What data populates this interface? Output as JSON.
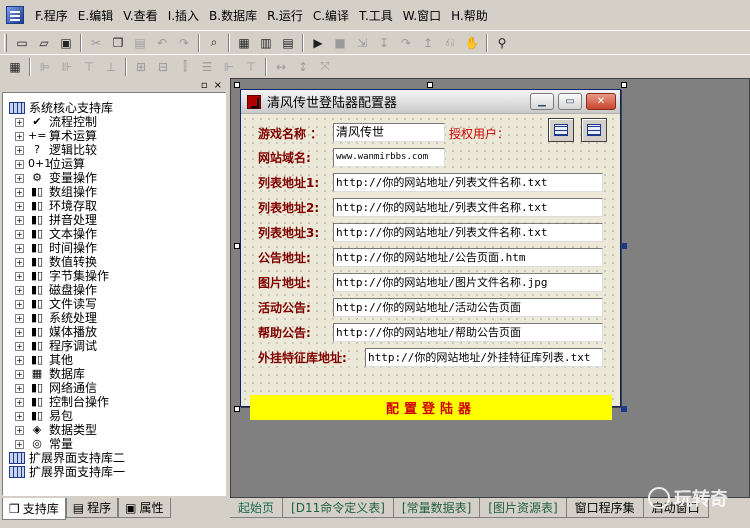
{
  "menu": [
    "F.程序",
    "E.编辑",
    "V.查看",
    "I.插入",
    "B.数据库",
    "R.运行",
    "C.编译",
    "T.工具",
    "W.窗口",
    "H.帮助"
  ],
  "panel_controls": [
    "▫",
    "×"
  ],
  "tree": {
    "root": "系统核心支持库",
    "children": [
      {
        "icon": "✔",
        "label": "流程控制"
      },
      {
        "icon": "+=",
        "label": "算术运算"
      },
      {
        "icon": "?",
        "label": "逻辑比较"
      },
      {
        "icon": "0+1",
        "label": "位运算"
      },
      {
        "icon": "⚙",
        "label": "变量操作"
      },
      {
        "icon": "▮▯",
        "label": "数组操作"
      },
      {
        "icon": "▮▯",
        "label": "环境存取"
      },
      {
        "icon": "▮▯",
        "label": "拼音处理"
      },
      {
        "icon": "▮▯",
        "label": "文本操作"
      },
      {
        "icon": "▮▯",
        "label": "时间操作"
      },
      {
        "icon": "▮▯",
        "label": "数值转换"
      },
      {
        "icon": "▮▯",
        "label": "字节集操作"
      },
      {
        "icon": "▮▯",
        "label": "磁盘操作"
      },
      {
        "icon": "▮▯",
        "label": "文件读写"
      },
      {
        "icon": "▮▯",
        "label": "系统处理"
      },
      {
        "icon": "▮▯",
        "label": "媒体播放"
      },
      {
        "icon": "▮▯",
        "label": "程序调试"
      },
      {
        "icon": "▮▯",
        "label": "其他"
      },
      {
        "icon": "▦",
        "label": "数据库"
      },
      {
        "icon": "▮▯",
        "label": "网络通信"
      },
      {
        "icon": "▮▯",
        "label": "控制台操作"
      },
      {
        "icon": "▮▯",
        "label": "易包"
      },
      {
        "icon": "◈",
        "label": "数据类型"
      },
      {
        "icon": "◎",
        "label": "常量"
      }
    ],
    "extra_roots": [
      "扩展界面支持库二",
      "扩展界面支持库一"
    ]
  },
  "left_tabs": [
    "支持库",
    "程序",
    "属性"
  ],
  "form": {
    "title": "清风传世登陆器配置器",
    "rows": {
      "game_name_label": "游戏名称 ：",
      "game_name_value": "清风传世",
      "authorized_label": "授权用户：",
      "domain_label": "网站域名:",
      "domain_value": "www.wanmirbbs.com",
      "list1_label": "列表地址1:",
      "list1_value": "http://你的网站地址/列表文件名称.txt",
      "list2_label": "列表地址2:",
      "list2_value": "http://你的网站地址/列表文件名称.txt",
      "list3_label": "列表地址3:",
      "list3_value": "http://你的网站地址/列表文件名称.txt",
      "notice_label": "公告地址:",
      "notice_value": "http://你的网站地址/公告页面.htm",
      "image_label": "图片地址:",
      "image_value": "http://你的网站地址/图片文件名称.jpg",
      "activity_label": "活动公告:",
      "activity_value": "http://你的网站地址/活动公告页面",
      "help_label": "帮助公告:",
      "help_value": "http://你的网站地址/帮助公告页面",
      "cheat_label": "外挂特征库地址:",
      "cheat_value": "http://你的网站地址/外挂特征库列表.txt"
    },
    "configure_button": "配置登陆器"
  },
  "bottom_tabs": [
    "起始页",
    "[D11命令定义表]",
    "[常量数据表]",
    "[图片资源表]",
    "窗口程序集",
    "启动窗口"
  ],
  "watermark": "玩转奇"
}
